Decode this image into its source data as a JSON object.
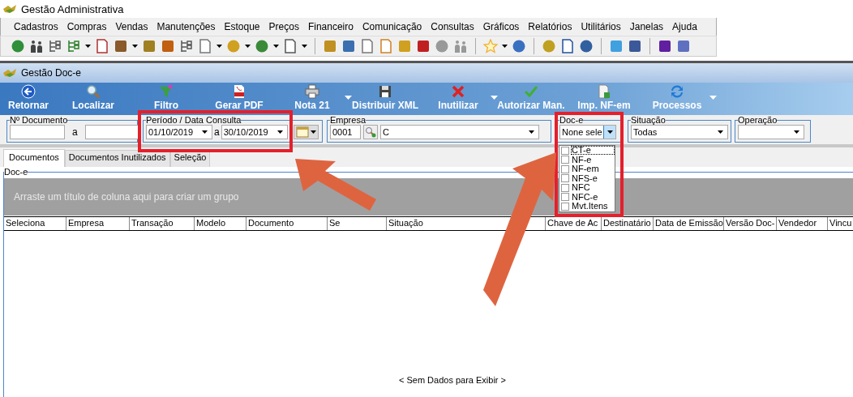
{
  "window": {
    "title": "Gestão Administrativa"
  },
  "menu": [
    "Cadastros",
    "Compras",
    "Vendas",
    "Manutenções",
    "Estoque",
    "Preços",
    "Financeiro",
    "Comunicação",
    "Consultas",
    "Gráficos",
    "Relatórios",
    "Utilitários",
    "Janelas",
    "Ajuda"
  ],
  "child_window": {
    "title": "Gestão Doc-e"
  },
  "ribbon": [
    {
      "label": "Retornar",
      "dropdown": false
    },
    {
      "label": "Localizar",
      "dropdown": false
    },
    {
      "label": "Filtro",
      "dropdown": false
    },
    {
      "label": "Gerar PDF",
      "dropdown": false
    },
    {
      "label": "Nota 21",
      "dropdown": true
    },
    {
      "label": "Distribuir XML",
      "dropdown": false
    },
    {
      "label": "Inutilizar",
      "dropdown": true
    },
    {
      "label": "Autorizar Man.",
      "dropdown": false
    },
    {
      "label": "Imp. NF-em",
      "dropdown": false
    },
    {
      "label": "Processos",
      "dropdown": true
    }
  ],
  "filters": {
    "doc_number": {
      "label": "Nº Documento",
      "separator": "a"
    },
    "period": {
      "label": "Período / Data Consulta",
      "from": "01/10/2019",
      "separator": "a",
      "to": "30/10/2019"
    },
    "company": {
      "label": "Empresa",
      "code": "0001",
      "name": "C"
    },
    "doc_type": {
      "label": "Doc-e",
      "value": "None sele",
      "expanded": true,
      "options": [
        {
          "label": "CT-e",
          "checked": false
        },
        {
          "label": "NF-e",
          "checked": false
        },
        {
          "label": "NF-em",
          "checked": false
        },
        {
          "label": "NFS-e",
          "checked": false
        },
        {
          "label": "NFC",
          "checked": false
        },
        {
          "label": "NFC-e",
          "checked": false
        },
        {
          "label": "Mvt.Itens",
          "checked": false
        }
      ]
    },
    "status": {
      "label": "Situação",
      "value": "Todas"
    },
    "operation": {
      "label": "Operação"
    }
  },
  "tabs": [
    {
      "label": "Documentos",
      "selected": true
    },
    {
      "label": "Documentos Inutilizados",
      "selected": false
    },
    {
      "label": "Seleção",
      "selected": false
    }
  ],
  "grid": {
    "title": "Doc-e",
    "group_hint": "Arraste um título de coluna aqui para criar um grupo",
    "columns": [
      "Seleciona",
      "Empresa",
      "Transação",
      "Modelo",
      "Documento",
      "Se",
      "Situação",
      "Chave de Ac",
      "Destinatário",
      "Data de Emissão",
      "Versão Doc-",
      "Vendedor",
      "Vincu"
    ],
    "empty_text": "< Sem Dados para Exibir >"
  }
}
